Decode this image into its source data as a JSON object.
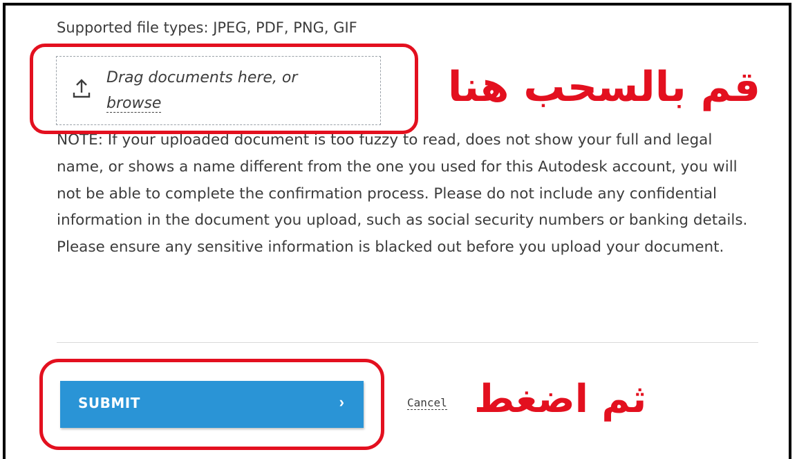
{
  "upload": {
    "supported_types": "Supported file types: JPEG, PDF, PNG, GIF",
    "drop_text": "Drag documents here, or",
    "browse_label": "browse"
  },
  "note": "NOTE: If your uploaded document is too fuzzy to read, does not show your full and legal name, or shows a name different from the one you used for this Autodesk account, you will not be able to complete the confirmation process. Please do not include any confidential information in the document you upload, such as social security numbers or banking details. Please ensure any sensitive information is blacked out before you upload your document.",
  "actions": {
    "submit_label": "SUBMIT",
    "submit_chevron": "›",
    "cancel_label": "Cancel"
  },
  "annotations": {
    "drag_caption": "قم بالسحب هنا",
    "submit_caption": "ثم اضغط",
    "color": "#e3101f"
  },
  "colors": {
    "submit_bg": "#2a94d6",
    "text": "#3c3c3c"
  },
  "icons": {
    "upload": "upload-icon",
    "submit_arrow": "chevron-right-icon"
  }
}
